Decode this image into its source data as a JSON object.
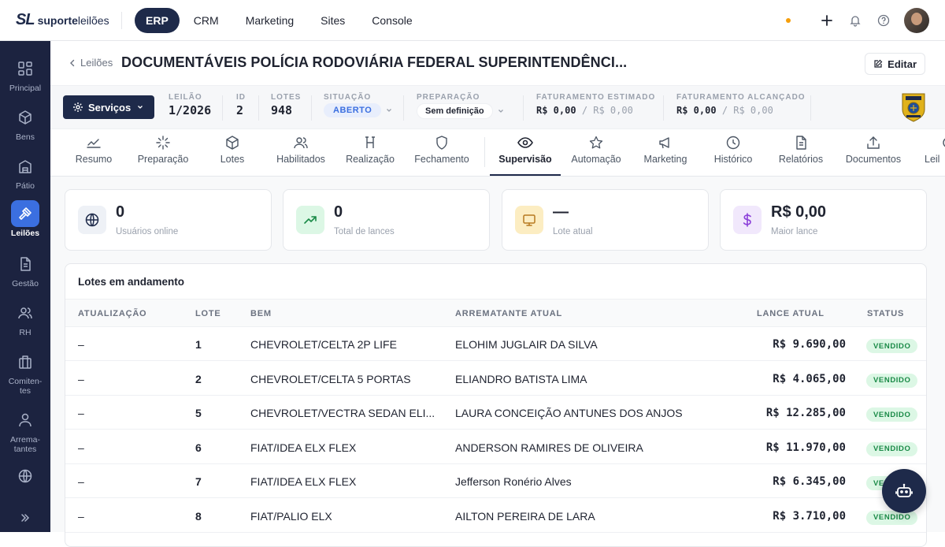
{
  "brand": {
    "mark": "SL",
    "name_bold": "suporte",
    "name_light": "leilões"
  },
  "top_nav": [
    "ERP",
    "CRM",
    "Marketing",
    "Sites",
    "Console"
  ],
  "sidebar": [
    {
      "label": "Principal",
      "icon": "grid-icon"
    },
    {
      "label": "Bens",
      "icon": "box-icon"
    },
    {
      "label": "Pátio",
      "icon": "warehouse-icon"
    },
    {
      "label": "Leilões",
      "icon": "gavel-icon"
    },
    {
      "label": "Gestão",
      "icon": "document-icon"
    },
    {
      "label": "RH",
      "icon": "users-icon"
    },
    {
      "label": "Comiten-\ntes",
      "icon": "building-icon"
    },
    {
      "label": "Arrema-\ntantes",
      "icon": "user-icon"
    },
    {
      "label": "",
      "icon": "globe-icon"
    }
  ],
  "header": {
    "back": "Leilões",
    "title": "DOCUMENTÁVEIS POLÍCIA RODOVIÁRIA FEDERAL SUPERINTENDÊNCI...",
    "edit": "Editar"
  },
  "info": {
    "services": "Serviços",
    "leilao_label": "LEILÃO",
    "leilao": "1/2026",
    "id_label": "ID",
    "id": "2",
    "lotes_label": "LOTES",
    "lotes": "948",
    "situacao_label": "SITUAÇÃO",
    "situacao": "ABERTO",
    "preparacao_label": "PREPARAÇÃO",
    "preparacao": "Sem definição",
    "fat_est_label": "FATURAMENTO ESTIMADO",
    "fat_est": "R$ 0,00",
    "fat_est_of": "/ R$ 0,00",
    "fat_alc_label": "FATURAMENTO ALCANÇADO",
    "fat_alc": "R$ 0,00",
    "fat_alc_of": "/ R$ 0,00"
  },
  "tabs": [
    "Resumo",
    "Preparação",
    "Lotes",
    "Habilitados",
    "Realização",
    "Fechamento",
    "Supervisão",
    "Automação",
    "Marketing",
    "Histórico",
    "Relatórios",
    "Documentos",
    "Leil"
  ],
  "active_tab": "Supervisão",
  "stats": [
    {
      "value": "0",
      "label": "Usuários online",
      "icon": "globe-icon"
    },
    {
      "value": "0",
      "label": "Total de lances",
      "icon": "trending-up-icon"
    },
    {
      "value": "—",
      "label": "Lote atual",
      "icon": "monitor-icon"
    },
    {
      "value": "R$ 0,00",
      "label": "Maior lance",
      "icon": "dollar-icon"
    }
  ],
  "panel": {
    "title": "Lotes em andamento",
    "columns": [
      "ATUALIZAÇÃO",
      "LOTE",
      "BEM",
      "ARREMATANTE ATUAL",
      "LANCE ATUAL",
      "STATUS"
    ],
    "rows": [
      {
        "upd": "–",
        "lote": "1",
        "bem": "CHEVROLET/CELTA 2P LIFE",
        "arr": "ELOHIM JUGLAIR DA SILVA",
        "lance": "R$ 9.690,00",
        "status": "VENDIDO"
      },
      {
        "upd": "–",
        "lote": "2",
        "bem": "CHEVROLET/CELTA 5 PORTAS",
        "arr": "ELIANDRO BATISTA LIMA",
        "lance": "R$ 4.065,00",
        "status": "VENDIDO"
      },
      {
        "upd": "–",
        "lote": "5",
        "bem": "CHEVROLET/VECTRA SEDAN ELI...",
        "arr": "LAURA CONCEIÇÃO ANTUNES DOS ANJOS",
        "lance": "R$ 12.285,00",
        "status": "VENDIDO"
      },
      {
        "upd": "–",
        "lote": "6",
        "bem": "FIAT/IDEA ELX FLEX",
        "arr": "ANDERSON RAMIRES DE OLIVEIRA",
        "lance": "R$ 11.970,00",
        "status": "VENDIDO"
      },
      {
        "upd": "–",
        "lote": "7",
        "bem": "FIAT/IDEA ELX FLEX",
        "arr": "Jefferson Ronério Alves",
        "lance": "R$ 6.345,00",
        "status": "VENDIDO"
      },
      {
        "upd": "–",
        "lote": "8",
        "bem": "FIAT/PALIO ELX",
        "arr": "AILTON PEREIRA DE LARA",
        "lance": "R$ 3.710,00",
        "status": "VENDIDO"
      }
    ]
  },
  "colors": {
    "navy": "#1e2a4a",
    "sidebar": "#1c2340",
    "accent": "#3b6fe0",
    "sold_bg": "#dcf7e5",
    "sold_fg": "#1a8a47",
    "status_dot": "#f59e0b"
  }
}
